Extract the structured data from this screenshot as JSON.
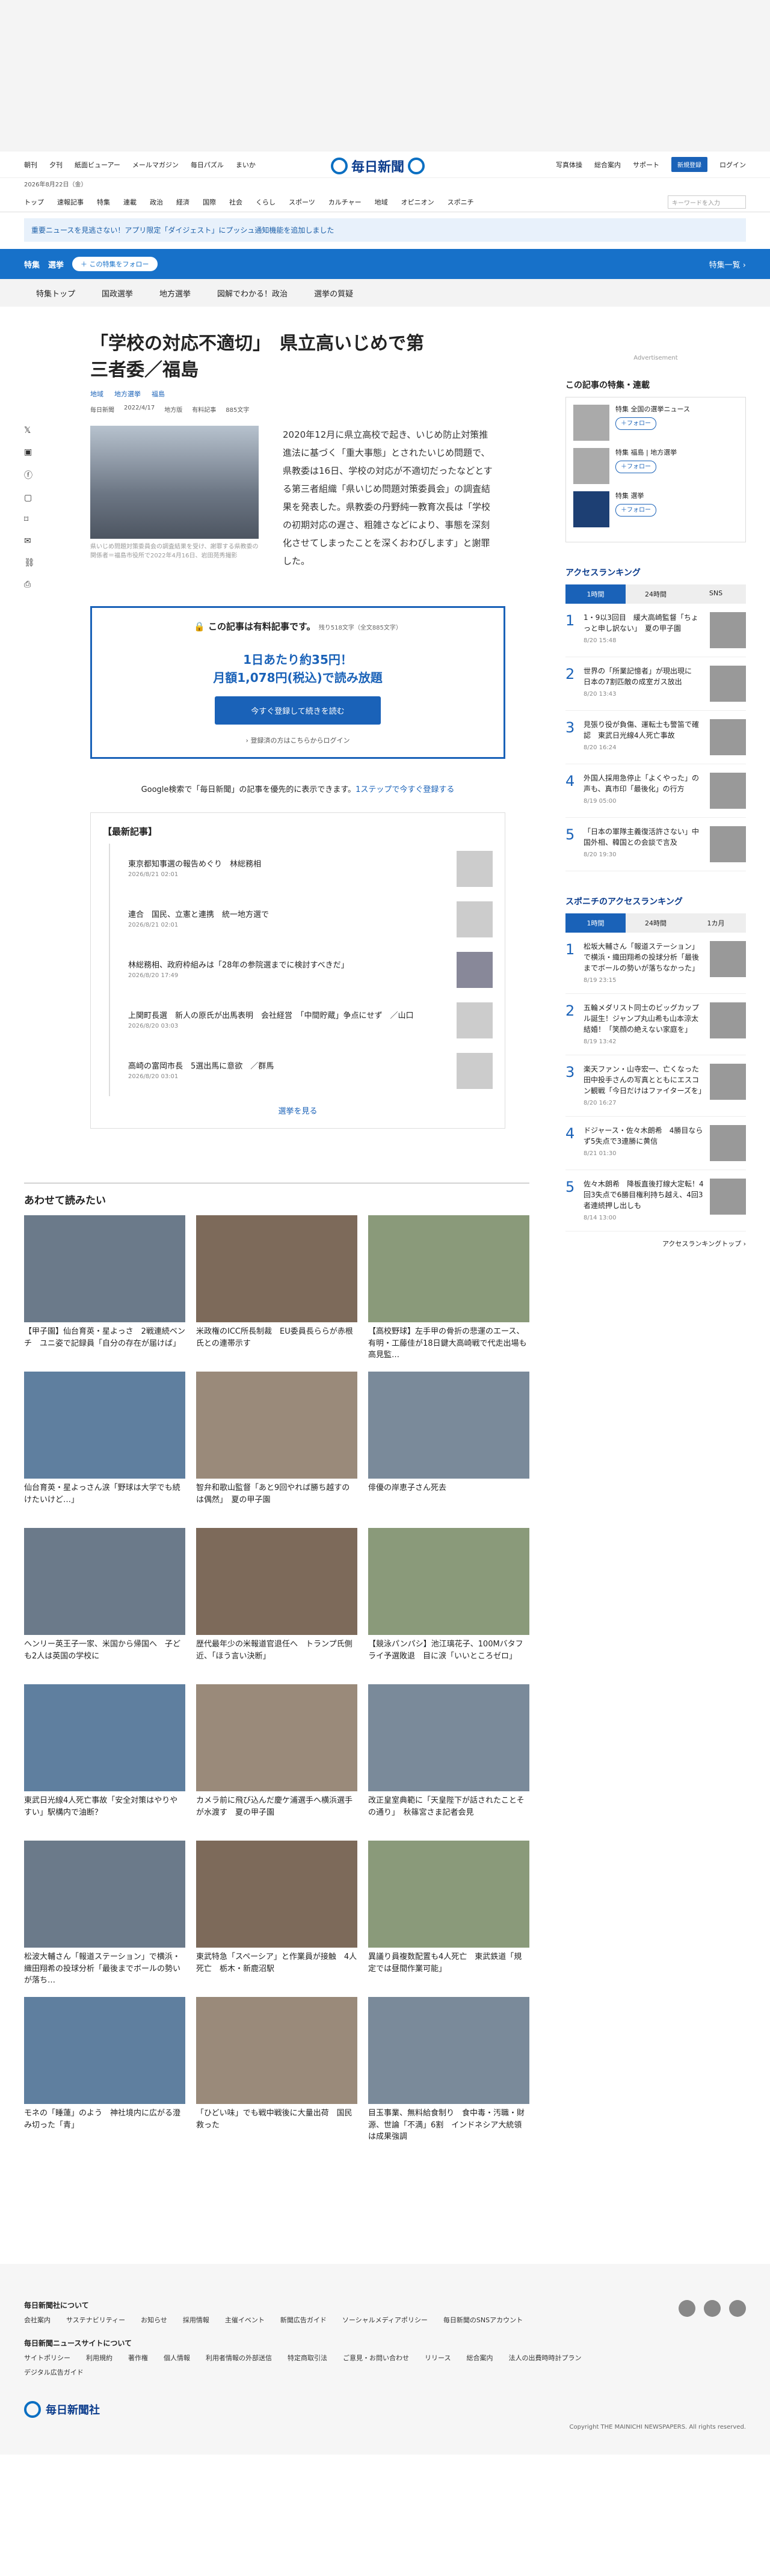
{
  "header": {
    "nav_left": [
      "朝刊",
      "夕刊",
      "紙面ビューアー",
      "メールマガジン",
      "毎日パズル",
      "まいか"
    ],
    "logo": "毎日新聞",
    "nav_right": [
      "写真体操",
      "総合案内",
      "サポート"
    ],
    "register": "新規登録",
    "login": "ログイン",
    "date": "2026年8月22日（金）"
  },
  "gnav": [
    "トップ",
    "速報記事",
    "特集",
    "連載",
    "政治",
    "経済",
    "国際",
    "社会",
    "くらし",
    "スポーツ",
    "カルチャー",
    "地域",
    "オピニオン",
    "スポニチ"
  ],
  "search_placeholder": "キーワードを入力",
  "notice": "重要ニュースを見逃さない！アプリ限定「ダイジェスト」にプッシュ通知機能を追加しました",
  "feature": {
    "tag": "特集",
    "name": "選挙",
    "follow": "＋ この特集をフォロー",
    "more": "特集一覧 ›"
  },
  "subnav": [
    "特集トップ",
    "国政選挙",
    "地方選挙",
    "図解でわかる！政治",
    "選挙の質疑"
  ],
  "article": {
    "title": "「学校の対応不適切」　県立高いじめで第三者委／福島",
    "cats": [
      "地域",
      "地方選挙",
      "福島"
    ],
    "meta": [
      "毎日新聞",
      "2022/4/17",
      "地方版",
      "有料記事",
      "885文字"
    ],
    "caption": "県いじめ問題対策委員会の調査結果を受け、謝罪する県教委の関係者＝福島市役所で2022年4月16日、岩田苑秀撮影",
    "lead": "2020年12月に県立高校で起き、いじめ防止対策推進法に基づく「重大事態」とされたいじめ問題で、県教委は16日、学校の対応が不適切だったなどとする第三者組織「県いじめ問題対策委員会」の調査結果を発表した。県教委の丹野純一教育次長は「学校の初期対応の遅さ、粗雑さなどにより、事態を深刻化させてしまったことを深くおわびします」と謝罪した。"
  },
  "paywall": {
    "title": "この記事は有料記事です。",
    "remain": "残り518文字（全文885文字）",
    "price1": "1日あたり約35円！",
    "price2": "月額1,078円(税込)で読み放題",
    "button": "今すぐ登録して続きを読む",
    "login": "› 登録済の方はこちらからログイン"
  },
  "google": {
    "text": "Google検索で「毎日新聞」の記事を優先的に表示できます。",
    "link": "1ステップで今すぐ登録する"
  },
  "latest": {
    "title": "【最新記事】",
    "items": [
      {
        "t": "東京都知事選の報告めぐり　林総務相",
        "d": "2026/8/21 02:01"
      },
      {
        "t": "連合　国民、立憲と連携　統一地方選で",
        "d": "2026/8/21 02:01"
      },
      {
        "t": "林総務相、政府枠組みは「28年の参院選までに検討すべきだ」",
        "d": "2026/8/20 17:49"
      },
      {
        "t": "上関町長選　新人の原氏が出馬表明　会社経営　「中間貯蔵」争点にせず　／山口",
        "d": "2026/8/20 03:03"
      },
      {
        "t": "高崎の富岡市長　5選出馬に意欲　／群馬",
        "d": "2026/8/20 03:01"
      }
    ],
    "more": "選挙を見る"
  },
  "also": {
    "title": "あわせて読みたい",
    "items": [
      "【甲子園】仙台育英・星よっさ　2戦連続ベンチ　ユニ姿で記録員「自分の存在が届けば」",
      "米政権のICC所長制裁　EU委員長ららが赤根氏との連帯示す",
      "【高校野球】左手甲の骨折の悲運のエース、有明・工藤佳が18日鍵大高崎戦で代走出場も　高見監…",
      "仙台育英・星よっさん涙「野球は大学でも続けたいけど…」",
      "智弁和歌山監督「あと9回やれば勝ち越すのは偶然」　夏の甲子園",
      "俳優の岸恵子さん死去",
      "ヘンリー英王子一家、米国から帰国へ　子ども2人は英国の学校に",
      "歴代最年少の米報道官退任へ　トランプ氏側近、「ほう言い決断」",
      "【競泳パンパシ】池江璃花子、100Mバタフライ予選敗退　目に涙「いいところゼロ」",
      "東武日光線4人死亡事故「安全対策はやりやすい」駅構内で油断？",
      "カメラ前に飛び込んだ慶ケ浦選手へ横浜選手が水渡す　夏の甲子園",
      "改正皇室典範に「天皇陛下が話されたことその通り」　秋篠宮さま記者会見",
      "松波大輔さん「報道ステーション」で横浜・織田翔希の投球分析「最後までボールの勢いが落ち…",
      "東武特急「スペーシア」と作業員が接触　4人死亡　栃木・新鹿沼駅",
      "異議り員複数配置も4人死亡　東武鉄道「規定では昼間作業可能」",
      "モネの「睡蓮」のよう　神社境内に広がる澄み切った「青」",
      "「ひどい味」でも戦中戦後に大量出荷　国民救った",
      "目玉事業、無料給食制り　食中毒・汚職・財源、世論「不満」6割　インドネシア大統領は成果強調"
    ]
  },
  "side": {
    "ad": "Advertisement",
    "feat_title": "この記事の特集・連載",
    "feats": [
      {
        "t": "特集 全国の選挙ニュース",
        "f": "＋フォロー"
      },
      {
        "t": "特集 福島 | 地方選挙",
        "f": "＋フォロー"
      },
      {
        "t": "特集 選挙",
        "f": "＋フォロー"
      }
    ],
    "rank_title": "アクセスランキング",
    "tabs": [
      "1時間",
      "24時間",
      "SNS"
    ],
    "ranks": [
      {
        "t": "1・9以3回目　緩大高崎監督「ちょっと申し訳ない」　夏の甲子園",
        "d": "8/20 15:48"
      },
      {
        "t": "世界の「所業記憶者」が現出現に　日本の7割匹敵の成室ガス放出",
        "d": "8/20 13:43"
      },
      {
        "t": "見張り役が負傷、運転士も警笛で確認　東武日光線4人死亡事故",
        "d": "8/20 16:24"
      },
      {
        "t": "外国人採用急停止「よくやった」の声も、真市印「最後化」の行方",
        "d": "8/19 05:00"
      },
      {
        "t": "「日本の軍隊主義復活許さない」中国外相、韓国との会談で言及",
        "d": "8/20 19:30"
      }
    ],
    "rank2_title": "スポニチのアクセスランキング",
    "tabs2": [
      "1時間",
      "24時間",
      "1カ月"
    ],
    "ranks2": [
      {
        "t": "松坂大輔さん「報道ステーション」で横浜・織田翔希の投球分析「最後までボールの勢いが落ちなかった」",
        "d": "8/19 23:15"
      },
      {
        "t": "五輪メダリスト同士のビッグカップル誕生！ジャンプ丸山希も山本涼太結婚！「笑顔の絶えない家庭を」",
        "d": "8/19 13:42"
      },
      {
        "t": "楽天ファン・山寺宏一、亡くなった田中投手さんの写真とともにエスコン観戦「今日だけはファイターズを」",
        "d": "8/20 16:27"
      },
      {
        "t": "ドジャース・佐々木朗希　4勝目ならず5失点で3連勝に黄信",
        "d": "8/21 01:30"
      },
      {
        "t": "佐々木朗希　降板直後打線大定転！4回3失点で6勝目権利持ち越え、4回3者連続押し出しも",
        "d": "8/14 13:00"
      }
    ],
    "rank_more": "アクセスランキングトップ ›"
  },
  "footer": {
    "t1": "毎日新聞社について",
    "r1": [
      "会社案内",
      "サステナビリティー",
      "お知らせ",
      "採用情報",
      "主催イベント",
      "新聞広告ガイド",
      "ソーシャルメディアポリシー",
      "毎日新聞のSNSアカウント"
    ],
    "t2": "毎日新聞ニュースサイトについて",
    "r2": [
      "サイトポリシー",
      "利用規約",
      "著作権",
      "個人情報",
      "利用者情報の外部送信",
      "特定商取引法",
      "ご意見・お問い合わせ",
      "リリース",
      "総合案内",
      "法人の出費時時計プラン"
    ],
    "r3": [
      "デジタル広告ガイド"
    ],
    "logo": "毎日新聞社",
    "copy": "Copyright THE MAINICHI NEWSPAPERS. All rights reserved."
  }
}
